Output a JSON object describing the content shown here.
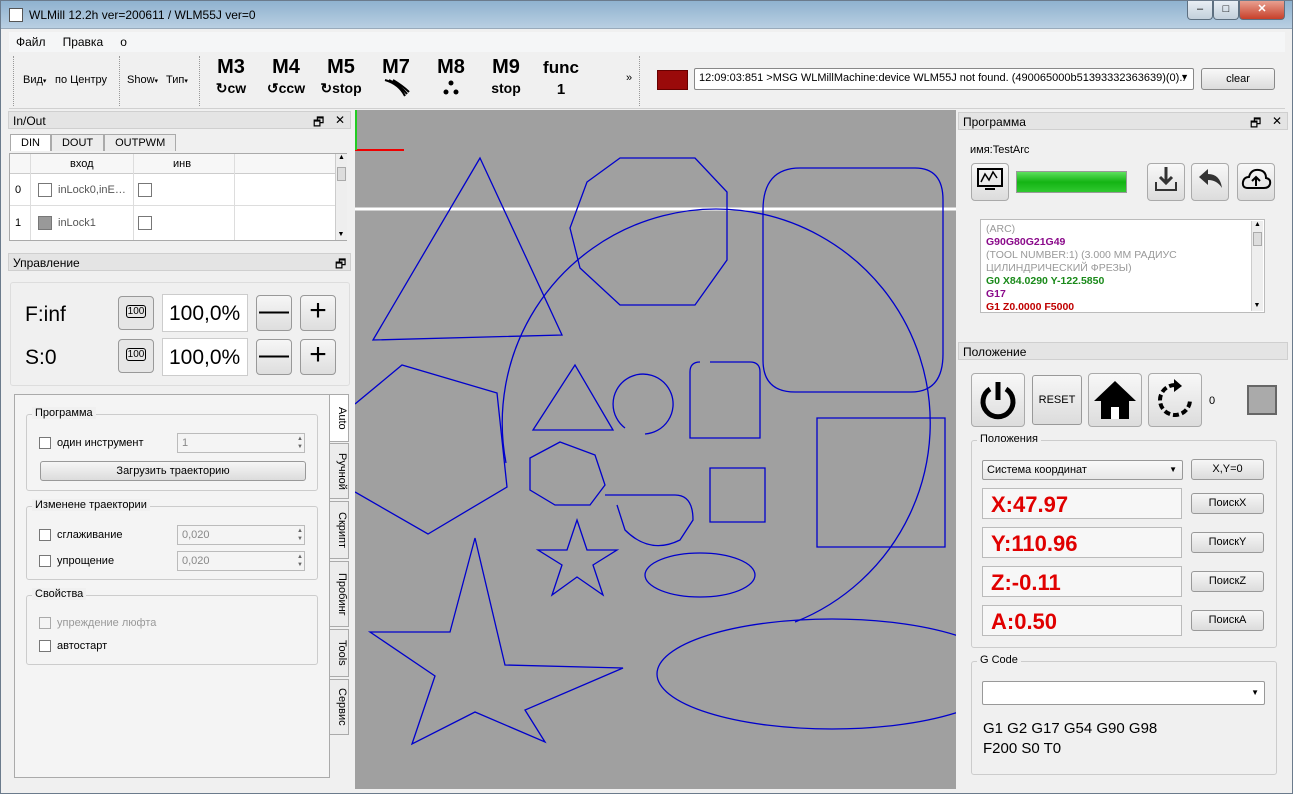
{
  "window": {
    "title": "WLMill 12.2h ver=200611 / WLM55J ver=0",
    "min": "–",
    "max": "□",
    "close": "✕"
  },
  "menu": [
    "Файл",
    "Правка",
    "o"
  ],
  "toolbar": {
    "vid": "Вид",
    "center": "по Центру",
    "show": "Show",
    "tip": "Тип",
    "mcodes": [
      {
        "code": "M3",
        "sub": "cw",
        "icon": "rotate-cw-icon"
      },
      {
        "code": "M4",
        "sub": "ccw",
        "icon": "rotate-ccw-icon"
      },
      {
        "code": "M5",
        "sub": "stop",
        "icon": "spindle-stop-icon"
      },
      {
        "code": "M7",
        "sub": "",
        "icon": "mist-coolant-icon"
      },
      {
        "code": "M8",
        "sub": "",
        "icon": "flood-coolant-icon"
      },
      {
        "code": "M9",
        "sub": "stop",
        "icon": "coolant-stop-icon"
      },
      {
        "code": "func",
        "sub": "1",
        "icon": ""
      }
    ],
    "more": "»",
    "message": "12:09:03:851 >MSG WLMillMachine:device WLM55J not found. (490065000b51393332363639)(0)..",
    "clear": "clear",
    "status_color": "#9a0a0a"
  },
  "inout": {
    "title": "In/Out",
    "tabs": [
      "DIN",
      "DOUT",
      "OUTPWM"
    ],
    "headers": [
      "вход",
      "инв"
    ],
    "rows": [
      {
        "idx": "0",
        "name": "inLock0,inE…"
      },
      {
        "idx": "1",
        "name": "inLock1"
      }
    ]
  },
  "control": {
    "title": "Управление",
    "f_label": "F:inf",
    "s_label": "S:0",
    "f_pct": "100,0%",
    "s_pct": "100,0%",
    "btn100": "100",
    "minus": "—",
    "plus": "+"
  },
  "auto": {
    "program_group": "Программа",
    "one_tool": "один инструмент",
    "one_tool_value": "1",
    "load": "Загрузить траекторию",
    "traj_group": "Изменене траектории",
    "smooth": "сглаживание",
    "smooth_value": "0,020",
    "simplify": "упрощение",
    "simplify_value": "0,020",
    "props_group": "Свойства",
    "backlash": "упреждение люфта",
    "autostart": "автостарт"
  },
  "side_tabs": [
    "Auto",
    "Ручной",
    "Скрипт",
    "Пробинг",
    "Tools",
    "Сервис"
  ],
  "program": {
    "title": "Программа",
    "name": "имя:TestArc",
    "progress": 1.0,
    "gcode": [
      {
        "t": "(ARC)",
        "c": "#999"
      },
      {
        "t": "G90G80G21G49",
        "c": "#8a0a8a",
        "b": true
      },
      {
        "t": "(TOOL NUMBER:1) (3.000 ММ РАДИУС",
        "c": "#999"
      },
      {
        "t": "ЦИЛИНДРИЧЕСКИЙ ФРЕЗЫ)",
        "c": "#999"
      },
      {
        "t": "G0 X84.0290 Y-122.5850",
        "c": "#1a8a1a",
        "b": true
      },
      {
        "t": "G17",
        "c": "#8a0a8a",
        "b": true
      },
      {
        "t": "G1 Z0.0000 F5000",
        "c": "#c00000",
        "b": true
      }
    ]
  },
  "position": {
    "title": "Положение",
    "reset": "RESET",
    "zero": "0",
    "group": "Положения",
    "coord_system": "Система координат",
    "xy0": "X,Y=0",
    "coords": [
      {
        "label": "X:47.97",
        "search": "ПоискX"
      },
      {
        "label": "Y:110.96",
        "search": "ПоискY"
      },
      {
        "label": "Z:-0.11",
        "search": "ПоискZ"
      },
      {
        "label": "A:0.50",
        "search": "ПоискA"
      }
    ]
  },
  "gcode_panel": {
    "title": "G Code",
    "input": "",
    "state1": "G1 G2 G17 G54 G90 G98",
    "state2": "F200 S0 T0"
  }
}
